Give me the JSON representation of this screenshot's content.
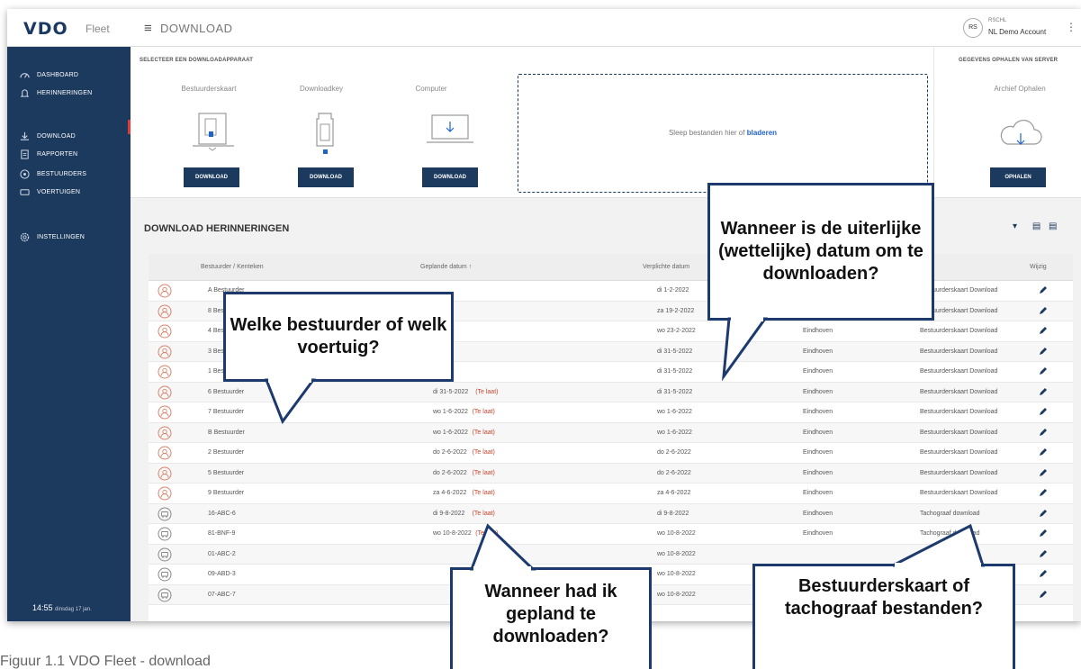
{
  "header": {
    "logo": "VDO",
    "logo_suffix": "Fleet",
    "menu_icon": "hamburger-icon",
    "page_title": "DOWNLOAD",
    "avatar_initials": "RS",
    "account_name": "RSCHL",
    "account_sub": "NL Demo Account"
  },
  "sidebar": {
    "items": [
      {
        "label": "DASHBOARD",
        "icon": "dashboard-icon"
      },
      {
        "label": "HERINNERINGEN",
        "icon": "bell-icon"
      },
      {
        "label": "DOWNLOAD",
        "icon": "download-icon"
      },
      {
        "label": "RAPPORTEN",
        "icon": "report-icon"
      },
      {
        "label": "BESTUURDERS",
        "icon": "driver-icon"
      },
      {
        "label": "VOERTUIGEN",
        "icon": "vehicle-icon"
      },
      {
        "label": "INSTELLINGEN",
        "icon": "gear-icon"
      }
    ],
    "active": "DOWNLOAD",
    "clock_time": "14:55",
    "clock_date": "dinsdag 17 jan."
  },
  "download_panel": {
    "section_label": "SELECTEER EEN DOWNLOADAPPARAAT",
    "devices": [
      {
        "label": "Bestuurderskaart",
        "button": "DOWNLOAD"
      },
      {
        "label": "Downloadkey",
        "button": "DOWNLOAD"
      },
      {
        "label": "Computer",
        "button": "DOWNLOAD"
      }
    ],
    "drop_text": "Sleep bestanden hier of",
    "drop_link": "bladeren",
    "server_label": "GEGEVENS OPHALEN VAN SERVER",
    "server_sub": "Archief Ophalen",
    "server_button": "OPHALEN"
  },
  "reminders": {
    "title": "DOWNLOAD HERINNERINGEN",
    "columns": [
      "Bestuurder / Kenteken",
      "Geplande datum ↑",
      "Verplichte datum",
      "Wijzig"
    ],
    "late_label": "(Te laat)",
    "rows": [
      {
        "name": "A Bestuurder",
        "planned": "",
        "required": "di 1-2-2022",
        "location": "",
        "type": "Bestuurderskaart Download",
        "kind": "driver"
      },
      {
        "name": "8 Bestuurder",
        "planned": "",
        "required": "za 19-2-2022",
        "location": "",
        "type": "Bestuurderskaart Download",
        "kind": "driver"
      },
      {
        "name": "4 Bestuurder",
        "planned": "",
        "required": "wo 23-2-2022",
        "location": "Eindhoven",
        "type": "Bestuurderskaart Download",
        "kind": "driver"
      },
      {
        "name": "3 Bestuurder",
        "planned": "",
        "required": "di 31-5-2022",
        "location": "Eindhoven",
        "type": "Bestuurderskaart Download",
        "kind": "driver"
      },
      {
        "name": "1 Bestuurder",
        "planned": "",
        "required": "di 31-5-2022",
        "location": "Eindhoven",
        "type": "Bestuurderskaart Download",
        "kind": "driver"
      },
      {
        "name": "6 Bestuurder",
        "planned": "di 31-5-2022",
        "required": "di 31-5-2022",
        "location": "Eindhoven",
        "type": "Bestuurderskaart Download",
        "kind": "driver"
      },
      {
        "name": "7 Bestuurder",
        "planned": "wo 1-6-2022",
        "required": "wo 1-6-2022",
        "location": "Eindhoven",
        "type": "Bestuurderskaart Download",
        "kind": "driver"
      },
      {
        "name": "B Bestuurder",
        "planned": "wo 1-6-2022",
        "required": "wo 1-6-2022",
        "location": "Eindhoven",
        "type": "Bestuurderskaart Download",
        "kind": "driver"
      },
      {
        "name": "2 Bestuurder",
        "planned": "do 2-6-2022",
        "required": "do 2-6-2022",
        "location": "Eindhoven",
        "type": "Bestuurderskaart Download",
        "kind": "driver"
      },
      {
        "name": "5 Bestuurder",
        "planned": "do 2-6-2022",
        "required": "do 2-6-2022",
        "location": "Eindhoven",
        "type": "Bestuurderskaart Download",
        "kind": "driver"
      },
      {
        "name": "9 Bestuurder",
        "planned": "za 4-6-2022",
        "required": "za 4-6-2022",
        "location": "Eindhoven",
        "type": "Bestuurderskaart Download",
        "kind": "driver"
      },
      {
        "name": "16-ABC-6",
        "planned": "di 9-8-2022",
        "required": "di 9-8-2022",
        "location": "Eindhoven",
        "type": "Tachograaf download",
        "kind": "vehicle"
      },
      {
        "name": "81-BNF-9",
        "planned": "wo 10-8-2022",
        "required": "wo 10-8-2022",
        "location": "Eindhoven",
        "type": "Tachograaf download",
        "kind": "vehicle"
      },
      {
        "name": "01-ABC-2",
        "planned": "",
        "required": "wo 10-8-2022",
        "location": "",
        "type": "",
        "kind": "vehicle"
      },
      {
        "name": "09-ABD-3",
        "planned": "",
        "required": "wo 10-8-2022",
        "location": "",
        "type": "",
        "kind": "vehicle"
      },
      {
        "name": "07-ABC-7",
        "planned": "",
        "required": "wo 10-8-2022",
        "location": "",
        "type": "",
        "kind": "vehicle"
      }
    ]
  },
  "callouts": {
    "driver": "Welke bestuurder of welk voertuig?",
    "required": "Wanneer is de uiterlijke (wettelijke) datum om te downloaden?",
    "planned": "Wanneer had ik gepland te downloaden?",
    "type": "Bestuurderskaart of tachograaf bestanden?"
  },
  "caption": "Figuur 1.1 VDO Fleet - download",
  "colors": {
    "navy": "#1c3a5e",
    "callout_border": "#1c3a6e",
    "late": "#c8452e",
    "link": "#1f63c4"
  }
}
